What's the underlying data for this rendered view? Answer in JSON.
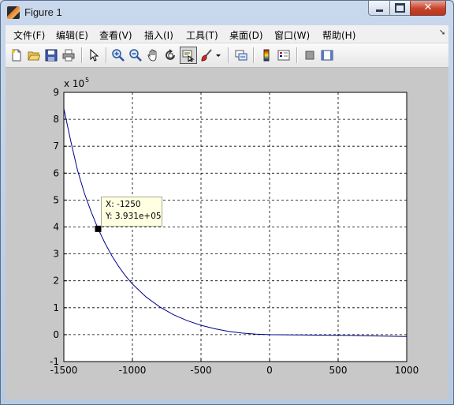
{
  "window": {
    "title": "Figure 1",
    "min_icon": "minimize-icon",
    "max_icon": "maximize-icon",
    "close_icon": "close-icon"
  },
  "menu": {
    "items": [
      "文件(F)",
      "编辑(E)",
      "查看(V)",
      "插入(I)",
      "工具(T)",
      "桌面(D)",
      "窗口(W)",
      "帮助(H)"
    ]
  },
  "toolbar": {
    "icons": [
      "new-figure-icon",
      "open-file-icon",
      "save-icon",
      "print-icon",
      "pointer-icon",
      "zoom-in-icon",
      "zoom-out-icon",
      "pan-icon",
      "rotate-3d-icon",
      "data-cursor-icon",
      "brush-icon",
      "brush-dropdown-icon",
      "link-plot-icon",
      "colorbar-icon",
      "legend-icon",
      "hide-plot-tools-icon",
      "show-plot-tools-icon"
    ],
    "active": "data-cursor-icon"
  },
  "colors": {
    "line": "#00008b",
    "grid": "#000000",
    "figure_background": "#c8c8c8",
    "axes_background": "#ffffff",
    "datatip_background": "#ffffe1"
  },
  "datatip": {
    "x_text": "X: -1250",
    "y_text": "Y: 3.931e+05"
  },
  "chart_data": {
    "type": "line",
    "title": "",
    "xlabel": "",
    "ylabel": "",
    "y_multiplier_label": "x 10",
    "y_multiplier_exponent": "5",
    "xlim": [
      -1500,
      1000
    ],
    "ylim": [
      -1,
      9
    ],
    "xticks": [
      -1500,
      -1000,
      -500,
      0,
      500,
      1000
    ],
    "xtick_labels": [
      "-1500",
      "-1000",
      "-500",
      "0",
      "500",
      "1000"
    ],
    "yticks": [
      -1,
      0,
      1,
      2,
      3,
      4,
      5,
      6,
      7,
      8,
      9
    ],
    "ytick_labels": [
      "-1",
      "0",
      "1",
      "2",
      "3",
      "4",
      "5",
      "6",
      "7",
      "8",
      "9"
    ],
    "grid": true,
    "grid_style": "dashed",
    "series": [
      {
        "x": [
          -1500,
          -1450,
          -1400,
          -1350,
          -1300,
          -1250,
          -1200,
          -1150,
          -1100,
          -1050,
          -1000,
          -900,
          -800,
          -700,
          -600,
          -500,
          -400,
          -300,
          -200,
          -100,
          0,
          200,
          400,
          600,
          800,
          1000
        ],
        "y": [
          8.4,
          7.2,
          6.1,
          5.25,
          4.55,
          3.93,
          3.4,
          2.93,
          2.53,
          2.18,
          1.88,
          1.4,
          1.03,
          0.74,
          0.52,
          0.35,
          0.22,
          0.12,
          0.06,
          0.02,
          0.0,
          -0.01,
          -0.02,
          -0.03,
          -0.05,
          -0.07
        ]
      }
    ],
    "marker": {
      "x": -1250,
      "y": 3.931
    }
  }
}
